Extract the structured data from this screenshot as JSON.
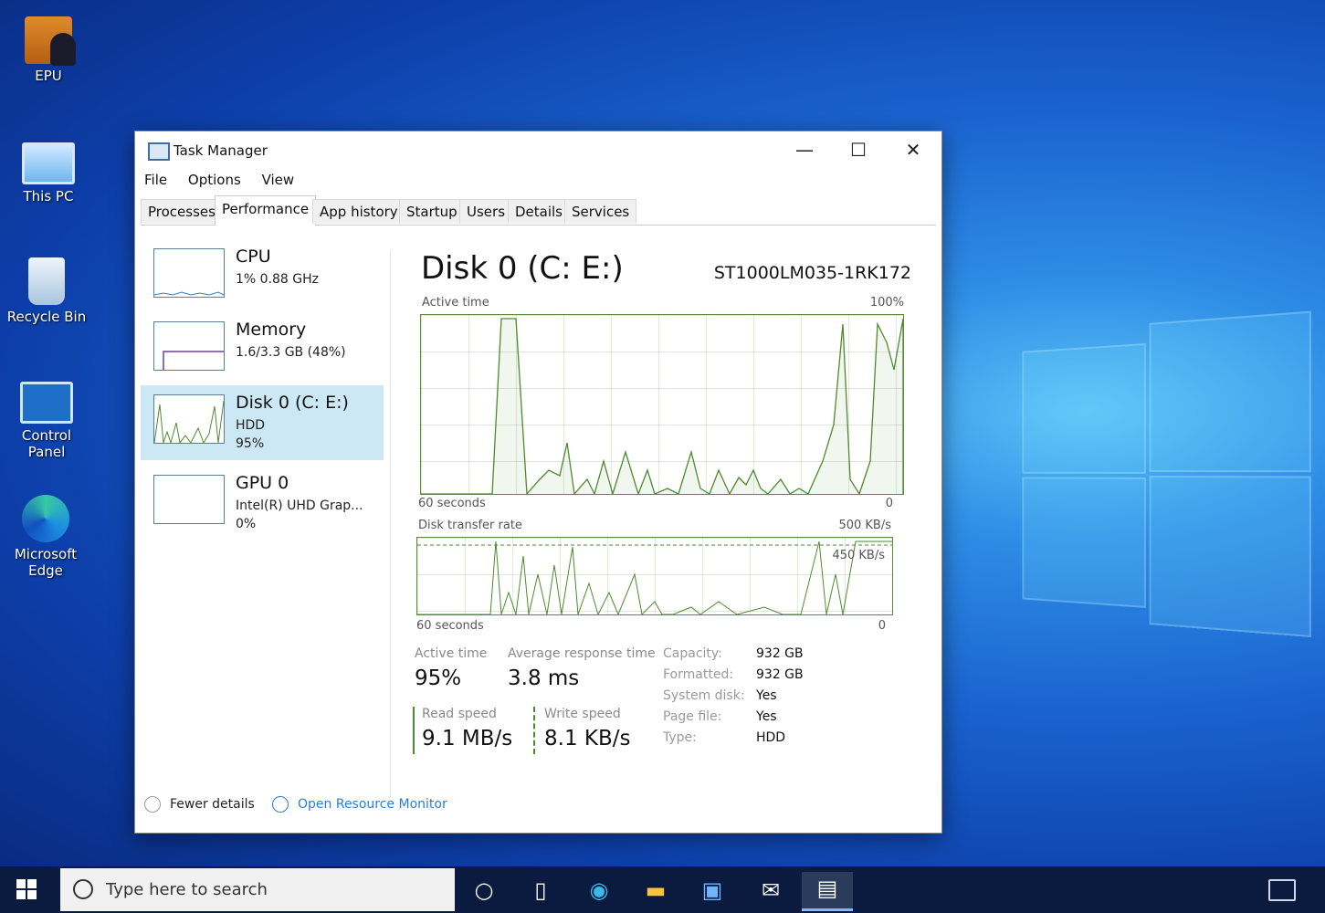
{
  "desktop": {
    "icons": [
      {
        "label": "EPU"
      },
      {
        "label": "This PC"
      },
      {
        "label": "Recycle Bin"
      },
      {
        "label": "Control Panel"
      },
      {
        "label": "Microsoft Edge"
      }
    ]
  },
  "window": {
    "title": "Task Manager",
    "minimize": "—",
    "maximize": "☐",
    "close": "✕",
    "menu": [
      "File",
      "Options",
      "View"
    ],
    "tabs": [
      "Processes",
      "Performance",
      "App history",
      "Startup",
      "Users",
      "Details",
      "Services"
    ],
    "active_tab": "Performance"
  },
  "sidebar": {
    "items": [
      {
        "name": "CPU",
        "line1": "1% 0.88 GHz",
        "line2": ""
      },
      {
        "name": "Memory",
        "line1": "1.6/3.3 GB (48%)",
        "line2": ""
      },
      {
        "name": "Disk 0 (C: E:)",
        "line1": "HDD",
        "line2": "95%"
      },
      {
        "name": "GPU 0",
        "line1": "Intel(R) UHD Grap...",
        "line2": "0%"
      }
    ],
    "selected": 2
  },
  "main": {
    "title": "Disk 0 (C: E:)",
    "model": "ST1000LM035-1RK172",
    "active_time_label": "Active time",
    "active_time_max": "100%",
    "graph1_xlabel": "60 seconds",
    "graph1_min": "0",
    "transfer_label": "Disk transfer rate",
    "transfer_max": "500 KB/s",
    "transfer_inner": "450 KB/s",
    "graph2_xlabel": "60 seconds",
    "graph2_min": "0",
    "stats": {
      "active_time_label": "Active time",
      "active_time_value": "95%",
      "avg_resp_label": "Average response time",
      "avg_resp_value": "3.8 ms",
      "read_label": "Read speed",
      "read_value": "9.1 MB/s",
      "write_label": "Write speed",
      "write_value": "8.1 KB/s"
    },
    "props": [
      {
        "key": "Capacity:",
        "value": "932 GB"
      },
      {
        "key": "Formatted:",
        "value": "932 GB"
      },
      {
        "key": "System disk:",
        "value": "Yes"
      },
      {
        "key": "Page file:",
        "value": "Yes"
      },
      {
        "key": "Type:",
        "value": "HDD"
      }
    ]
  },
  "footer": {
    "fewer_details": "Fewer details",
    "open_resource_monitor": "Open Resource Monitor"
  },
  "taskbar": {
    "search_placeholder": "Type here to search"
  },
  "colors": {
    "graph_line": "#4f8a2f",
    "selected_bg": "#cce8f5",
    "link": "#2a7dd6",
    "taskbar": "#0b1b3f"
  }
}
